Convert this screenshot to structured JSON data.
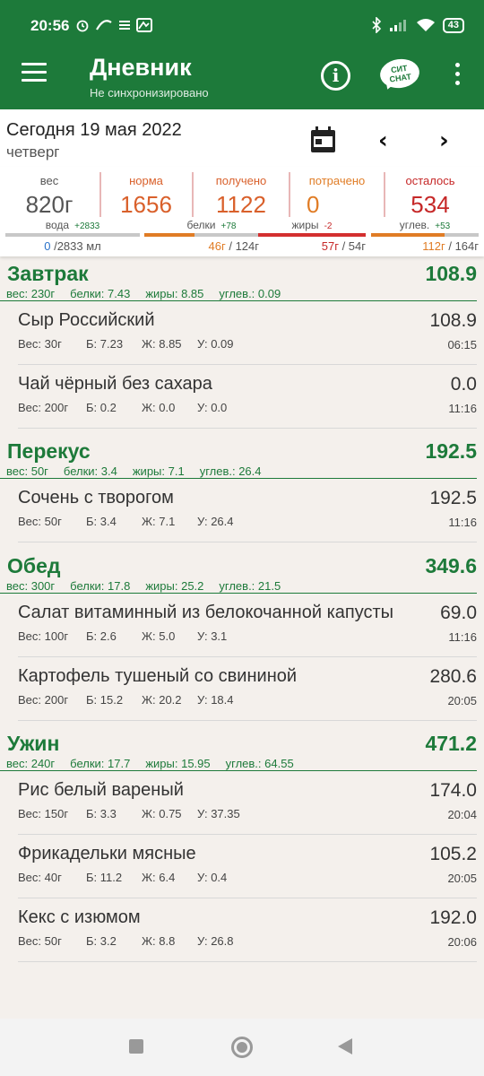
{
  "status_bar": {
    "time": "20:56",
    "battery": "43"
  },
  "app_bar": {
    "title": "Дневник",
    "subtitle": "Не синхронизировано",
    "info_glyph": "i",
    "chat_logo": "СИТ\nCHAT"
  },
  "date_row": {
    "date": "Сегодня 19 мая 2022",
    "weekday": "четверг",
    "prev": "‹",
    "next": "›"
  },
  "summary": {
    "columns": [
      {
        "label": "вес",
        "value": "820г",
        "color": "#555555"
      },
      {
        "label": "норма",
        "value": "1656",
        "color": "#d9602b"
      },
      {
        "label": "получено",
        "value": "1122",
        "color": "#d9602b"
      },
      {
        "label": "потрачено",
        "value": "0",
        "color": "#e07c25"
      },
      {
        "label": "осталось",
        "value": "534",
        "color": "#c62828"
      }
    ],
    "macros": [
      {
        "label": "вода",
        "delta": "+2833",
        "delta_color": "#1d7a3a",
        "current": "0",
        "total": "/2833 мл",
        "current_color": "#2a72c9",
        "bar_color": "#2a72c9",
        "fill": 0.0
      },
      {
        "label": "белки",
        "delta": "+78",
        "delta_color": "#1d7a3a",
        "current": "46г",
        "total": "/ 124г",
        "current_color": "#e07c25",
        "bar_color": "#e07c25",
        "fill": 0.37
      },
      {
        "label": "жиры",
        "delta": "-2",
        "delta_color": "#c62828",
        "current": "57г",
        "total": "/ 54г",
        "current_color": "#c62828",
        "bar_color": "#d32f2f",
        "fill": 1.0
      },
      {
        "label": "углев.",
        "delta": "+53",
        "delta_color": "#1d7a3a",
        "current": "112г",
        "total": "/ 164г",
        "current_color": "#e07c25",
        "bar_color": "#e07c25",
        "fill": 0.68
      }
    ]
  },
  "meals": [
    {
      "name": "Завтрак",
      "kcal": "108.9",
      "weight": "вес: 230г",
      "protein": "белки: 7.43",
      "fat": "жиры: 8.85",
      "carbs": "углев.: 0.09",
      "items": [
        {
          "name": "Сыр Российский",
          "kcal": "108.9",
          "weight": "Вес: 30г",
          "p": "Б: 7.23",
          "f": "Ж: 8.85",
          "c": "У: 0.09",
          "time": "06:15"
        },
        {
          "name": "Чай чёрный без сахара",
          "kcal": "0.0",
          "weight": "Вес: 200г",
          "p": "Б: 0.2",
          "f": "Ж: 0.0",
          "c": "У: 0.0",
          "time": "11:16"
        }
      ]
    },
    {
      "name": "Перекус",
      "kcal": "192.5",
      "weight": "вес: 50г",
      "protein": "белки: 3.4",
      "fat": "жиры: 7.1",
      "carbs": "углев.: 26.4",
      "items": [
        {
          "name": "Сочень с творогом",
          "kcal": "192.5",
          "weight": "Вес: 50г",
          "p": "Б: 3.4",
          "f": "Ж: 7.1",
          "c": "У: 26.4",
          "time": "11:16"
        }
      ]
    },
    {
      "name": "Обед",
      "kcal": "349.6",
      "weight": "вес: 300г",
      "protein": "белки: 17.8",
      "fat": "жиры: 25.2",
      "carbs": "углев.: 21.5",
      "items": [
        {
          "name": "Салат витаминный из белокочанной капусты",
          "kcal": "69.0",
          "weight": "Вес: 100г",
          "p": "Б: 2.6",
          "f": "Ж: 5.0",
          "c": "У: 3.1",
          "time": "11:16"
        },
        {
          "name": "Картофель тушеный со свининой",
          "kcal": "280.6",
          "weight": "Вес: 200г",
          "p": "Б: 15.2",
          "f": "Ж: 20.2",
          "c": "У: 18.4",
          "time": "20:05"
        }
      ]
    },
    {
      "name": "Ужин",
      "kcal": "471.2",
      "weight": "вес: 240г",
      "protein": "белки: 17.7",
      "fat": "жиры: 15.95",
      "carbs": "углев.: 64.55",
      "items": [
        {
          "name": "Рис белый вареный",
          "kcal": "174.0",
          "weight": "Вес: 150г",
          "p": "Б: 3.3",
          "f": "Ж: 0.75",
          "c": "У: 37.35",
          "time": "20:04"
        },
        {
          "name": "Фрикадельки мясные",
          "kcal": "105.2",
          "weight": "Вес: 40г",
          "p": "Б: 11.2",
          "f": "Ж: 6.4",
          "c": "У: 0.4",
          "time": "20:05"
        },
        {
          "name": "Кекс с изюмом",
          "kcal": "192.0",
          "weight": "Вес: 50г",
          "p": "Б: 3.2",
          "f": "Ж: 8.8",
          "c": "У: 26.8",
          "time": "20:06"
        }
      ]
    }
  ]
}
